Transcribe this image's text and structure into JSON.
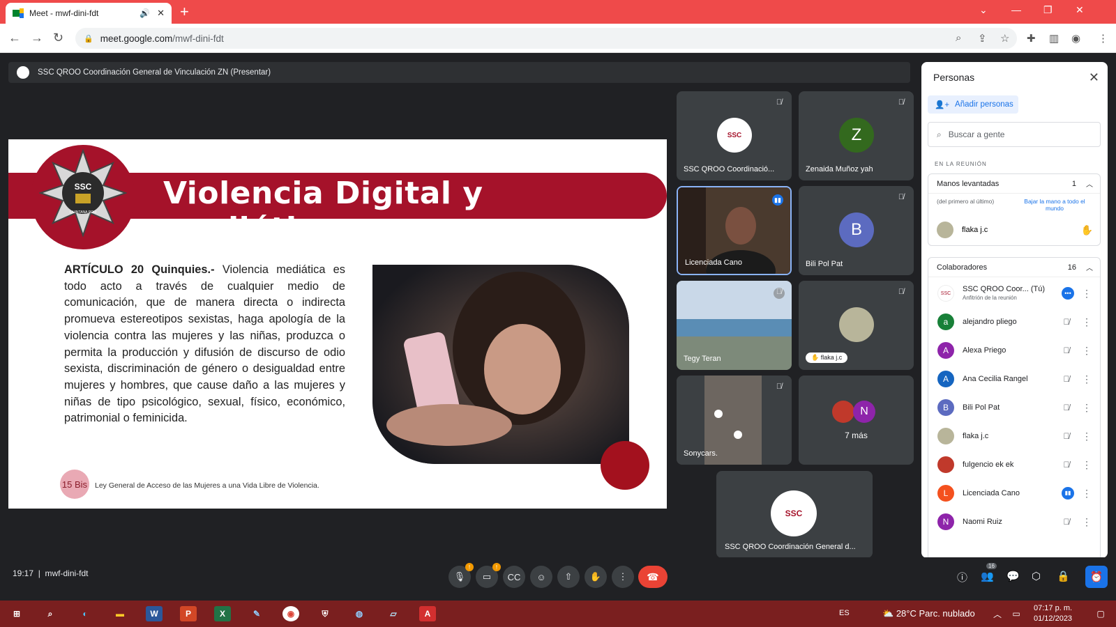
{
  "browser": {
    "tab_title": "Meet - mwf-dini-fdt",
    "url_host": "meet.google.com",
    "url_path": "/mwf-dini-fdt"
  },
  "presenting_bar": {
    "text": "SSC QROO Coordinación General de Vinculación ZN (Presentar)"
  },
  "slide": {
    "title": "Violencia Digital y mediática",
    "logo_text": "SSC",
    "logo_sub": "QUINTANA ROO",
    "article_label": "ARTÍCULO 20 Quinquies.-",
    "article_text": " Violencia mediática es todo acto a través de cualquier medio de comunicación, que de manera directa o indirecta promueva estereotipos sexistas, haga apología de la violencia contra las mujeres y las niñas, produzca o permita la producción y difusión de discurso de odio sexista, discriminación de género o desigualdad entre mujeres y hombres, que cause daño a las mujeres y niñas de tipo psicológico, sexual, físico, económico, patrimonial o feminicida.",
    "badge": "15 Bis",
    "footer": "Ley General de Acceso de las Mujeres a una Vida Libre de Violencia."
  },
  "tiles": [
    {
      "name": "SSC QROO Coordinació..."
    },
    {
      "name": "Zenaida Muñoz yah",
      "initial": "Z"
    },
    {
      "name": "Licenciada Cano"
    },
    {
      "name": "Bili Pol Pat",
      "initial": "B"
    },
    {
      "name": "Tegy Teran"
    },
    {
      "name": "flaka j.c"
    },
    {
      "name": "Sonycars."
    },
    {
      "more": "7 más",
      "initial": "N"
    },
    {
      "name": "SSC QROO Coordinación General d..."
    }
  ],
  "panel": {
    "title": "Personas",
    "add_people": "Añadir personas",
    "search_placeholder": "Buscar a gente",
    "section_label": "EN LA REUNIÓN",
    "raised_hands": {
      "label": "Manos levantadas",
      "count": "1",
      "order_note": "(del primero al último)",
      "lower_all": "Bajar la mano a todo el mundo",
      "person": "flaka j.c"
    },
    "collaborators": {
      "label": "Colaboradores",
      "count": "16"
    },
    "people": [
      {
        "name": "SSC QROO Coor...",
        "you": "(Tú)",
        "sub": "Anfitrión de la reunión",
        "initial": "",
        "color": "#ffffff"
      },
      {
        "name": "alejandro pliego",
        "initial": "a",
        "color": "#188038"
      },
      {
        "name": "Alexa Priego",
        "initial": "A",
        "color": "#8e24aa"
      },
      {
        "name": "Ana Cecilia Rangel",
        "initial": "A",
        "color": "#1565c0"
      },
      {
        "name": "Bili Pol Pat",
        "initial": "B",
        "color": "#5c6bc0"
      },
      {
        "name": "flaka j.c",
        "initial": "",
        "color": "#b8b59a"
      },
      {
        "name": "fulgencio ek ek",
        "initial": "",
        "color": "#c0392b"
      },
      {
        "name": "Licenciada Cano",
        "initial": "L",
        "color": "#f4511e"
      },
      {
        "name": "Naomi Ruiz",
        "initial": "N",
        "color": "#8e24aa"
      }
    ]
  },
  "bottombar": {
    "time": "19:17",
    "separator": "|",
    "meeting_code": "mwf-dini-fdt",
    "people_count": "16"
  },
  "taskbar": {
    "lang": "ES",
    "weather": "28°C  Parc. nublado",
    "time": "07:17 p. m.",
    "date": "01/12/2023"
  }
}
